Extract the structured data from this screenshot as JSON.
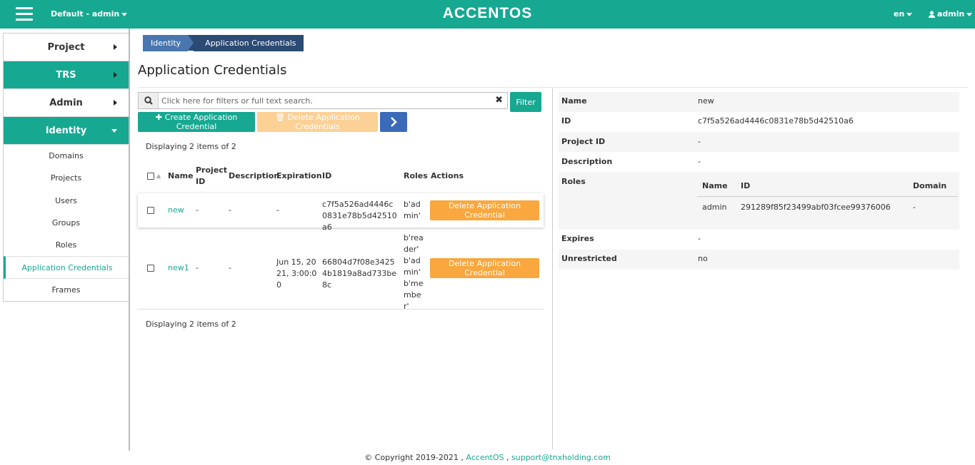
{
  "topbar": {
    "project": "Default - admin",
    "logo": "ACCENTOS",
    "language": "en",
    "user": "admin"
  },
  "sidebar": {
    "groups": [
      {
        "label": "Project"
      },
      {
        "label": "TRS"
      },
      {
        "label": "Admin"
      },
      {
        "label": "Identity"
      }
    ],
    "identity_items": [
      {
        "label": "Domains"
      },
      {
        "label": "Projects"
      },
      {
        "label": "Users"
      },
      {
        "label": "Groups"
      },
      {
        "label": "Roles"
      },
      {
        "label": "Application Credentials"
      },
      {
        "label": "Frames"
      }
    ]
  },
  "breadcrumb": {
    "parent": "Identity",
    "current": "Application Credentials"
  },
  "page_title": "Application Credentials",
  "search": {
    "placeholder": "Click here for filters or full text search.",
    "clear": "✖",
    "filter_label": "Filter"
  },
  "actions": {
    "create_label": "Create Application Credential",
    "delete_label": "Delete Application Credentials"
  },
  "display_count": "Displaying 2 items of 2",
  "table": {
    "headers": {
      "name": "Name",
      "project_id": "Project ID",
      "description": "Description",
      "expiration": "Expiration",
      "id": "ID",
      "roles": "Roles",
      "actions": "Actions"
    },
    "rows": [
      {
        "name": "new",
        "project_id": "-",
        "description": "-",
        "expiration": "-",
        "id": "c7f5a526ad4446c0831e78b5d42510a6",
        "roles": "b'admin'",
        "action": "Delete Application Credential"
      },
      {
        "name": "new1",
        "project_id": "-",
        "description": "-",
        "expiration": "Jun 15, 2021, 3:00:00",
        "id": "66804d7f08e34254b1819a8ad733be8c",
        "roles": "b'reader' b'admin' b'member'",
        "action": "Delete Application Credential"
      }
    ]
  },
  "detail": {
    "name_label": "Name",
    "name_value": "new",
    "id_label": "ID",
    "id_value": "c7f5a526ad4446c0831e78b5d42510a6",
    "project_id_label": "Project ID",
    "project_id_value": "-",
    "description_label": "Description",
    "description_value": "-",
    "roles_label": "Roles",
    "roles_table": {
      "headers": {
        "name": "Name",
        "id": "ID",
        "domain": "Domain"
      },
      "row": {
        "name": "admin",
        "id": "291289f85f23499abf03fcee99376006",
        "domain": "-"
      }
    },
    "expires_label": "Expires",
    "expires_value": "-",
    "unrestricted_label": "Unrestricted",
    "unrestricted_value": "no"
  },
  "footer": {
    "copyright": "© Copyright 2019-2021 ,",
    "brand": "AccentOS",
    "separator": ",",
    "email": "support@tnxholding.com"
  },
  "colors": {
    "accent": "#16a891",
    "warning": "#f9a73e",
    "primary": "#3a6bb8"
  }
}
